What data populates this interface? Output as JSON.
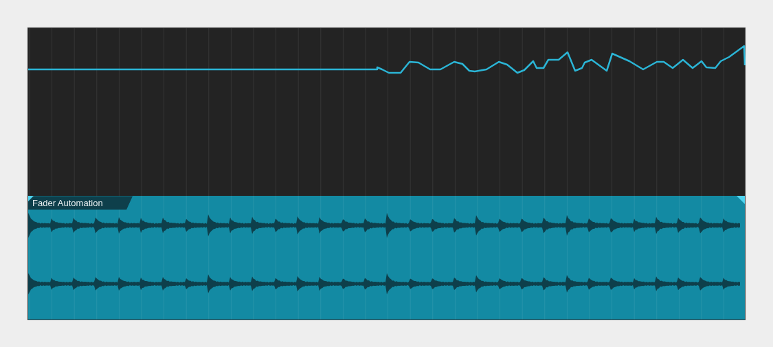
{
  "clip": {
    "title": "Fader Automation"
  }
}
